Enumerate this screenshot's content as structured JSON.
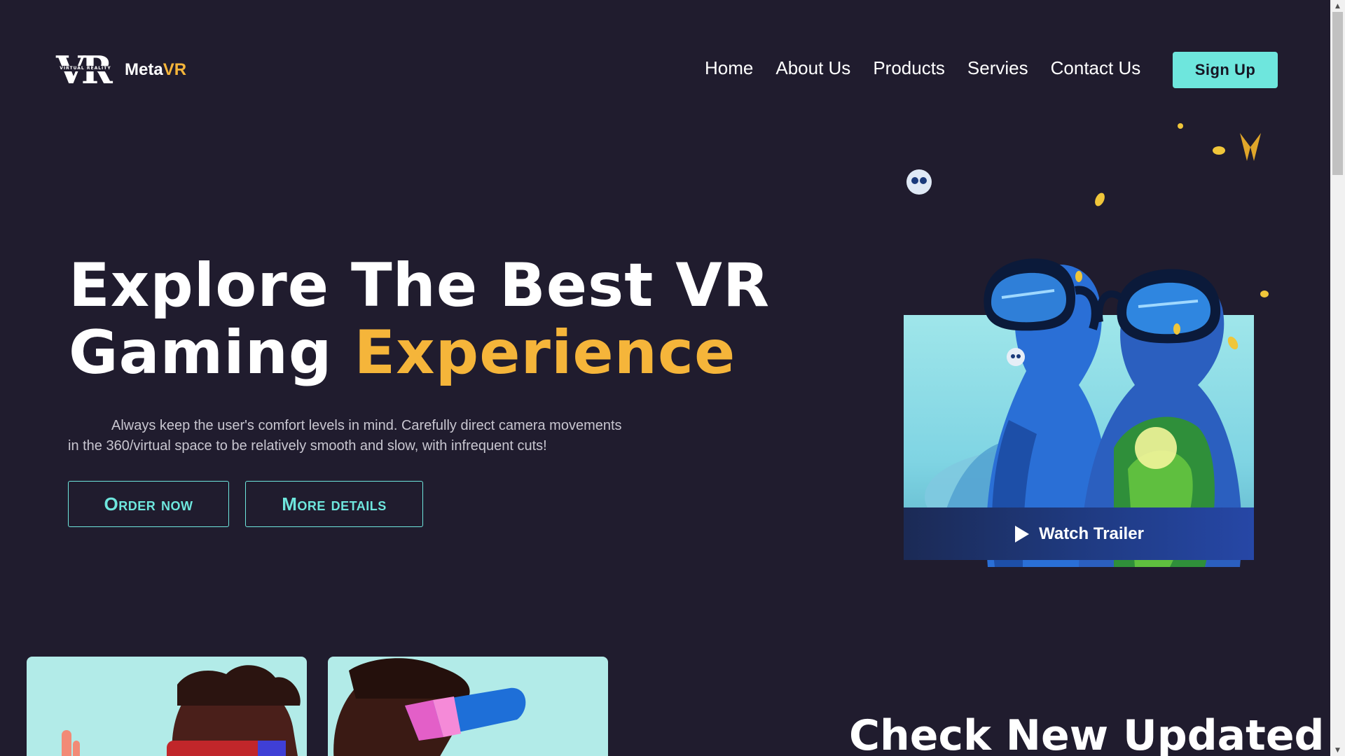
{
  "logo": {
    "mark": "VR",
    "mark_sub": "VIRTUAL REALITY",
    "name_part1": "Meta",
    "name_part2": "VR"
  },
  "nav": {
    "items": [
      "Home",
      "About Us",
      "Products",
      "Servies",
      "Contact Us"
    ]
  },
  "signup_label": "Sign Up",
  "hero": {
    "title_line1": "Explore The Best VR",
    "title_line2_part1": "Gaming ",
    "title_line2_part2": "Experience",
    "description": "Always keep the user's comfort levels in mind. Carefully direct camera movements in the 360/virtual space to be relatively smooth and slow, with infrequent cuts!",
    "order_button": "Order now",
    "more_button": "More details",
    "trailer_label": "Watch Trailer"
  },
  "section": {
    "title": "Check New Updated"
  },
  "colors": {
    "background": "#201c2e",
    "accent_orange": "#f5b53a",
    "accent_teal": "#6ee6dd",
    "card_teal": "#b2ebe8"
  },
  "icons": {
    "play": "play-icon",
    "scroll_up": "scroll-up-arrow-icon",
    "scroll_down": "scroll-down-arrow-icon"
  }
}
